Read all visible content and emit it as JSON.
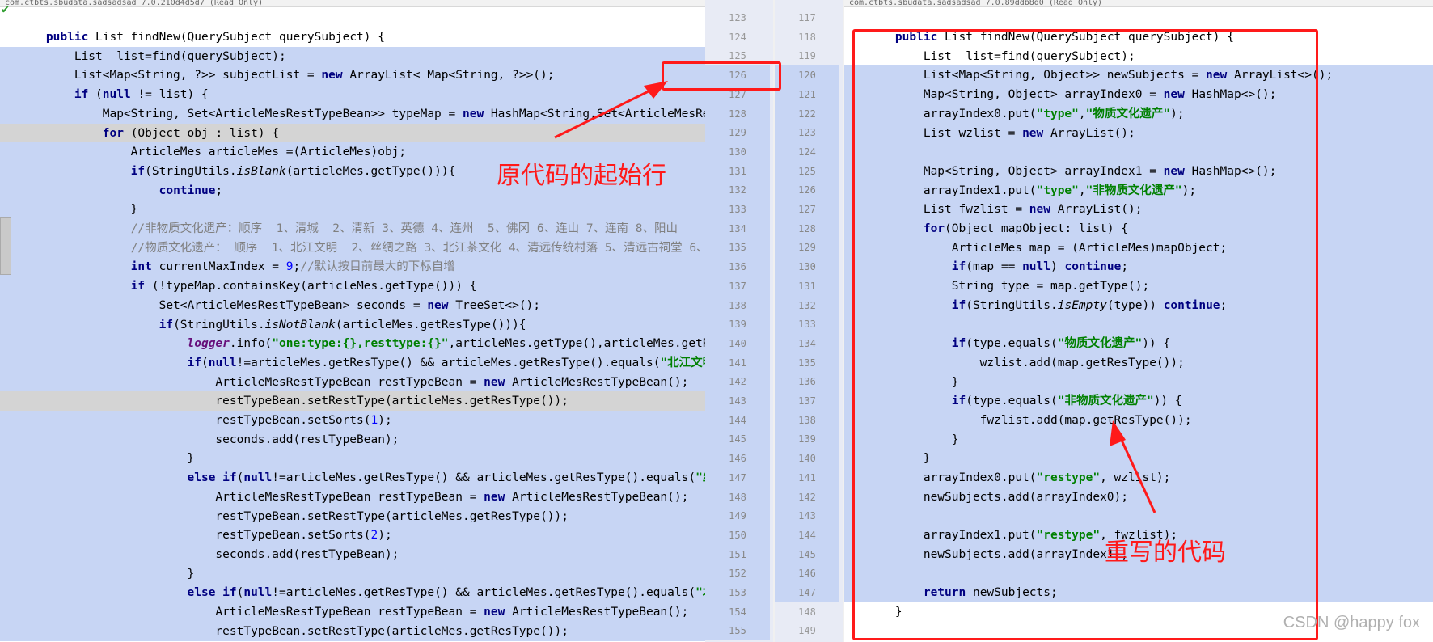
{
  "left_header": "com.ctbts.sbudata.sadsadsad 7.0.210d4d5d7 (Read Only)",
  "right_header": "com.ctbts.sbudata.sadsadsad 7.0.89ddb8d0 (Read Only)",
  "left_lines": [
    {
      "html": "    <span class='kw'>public</span> List findNew(QuerySubject querySubject) {",
      "bg": "none"
    },
    {
      "html": "        List  list=find(querySubject);",
      "bg": "sel"
    },
    {
      "html": "        List&lt;Map&lt;String, ?&gt;&gt; subjectList = <span class='kw'>new</span> ArrayList&lt; Map&lt;String, ?&gt;&gt;();",
      "bg": "sel"
    },
    {
      "html": "        <span class='kw'>if</span> (<span class='kw'>null</span> != list) {",
      "bg": "sel"
    },
    {
      "html": "            Map&lt;String, Set&lt;ArticleMesRestTypeBean&gt;&gt; typeMap = <span class='kw'>new</span> HashMap&lt;String,Set&lt;ArticleMesRestTypeBe",
      "bg": "sel"
    },
    {
      "html": "            <span class='kw'>for</span> (Object obj : list) {",
      "bg": "cur"
    },
    {
      "html": "                ArticleMes articleMes =(ArticleMes)obj;",
      "bg": "sel"
    },
    {
      "html": "                <span class='kw'>if</span>(StringUtils.<span class='ital'>isBlank</span>(articleMes.getType())){",
      "bg": "sel"
    },
    {
      "html": "                    <span class='kw'>continue</span>;",
      "bg": "sel"
    },
    {
      "html": "                }",
      "bg": "sel"
    },
    {
      "html": "                <span class='cmt'>//非物质文化遗产：顺序  1、清城  2、清新 3、英德 4、连州  5、佛冈 6、连山 7、连南 8、阳山</span>",
      "bg": "sel"
    },
    {
      "html": "                <span class='cmt'>//物质文化遗产： 顺序  1、北江文明  2、丝绸之路 3、北江茶文化 4、清远传统村落 5、清远古祠堂 6、</span>",
      "bg": "sel"
    },
    {
      "html": "                <span class='kw'>int</span> currentMaxIndex = <span class='num'>9</span>;<span class='cmt'>//默认按目前最大的下标自增</span>",
      "bg": "sel"
    },
    {
      "html": "                <span class='kw'>if</span> (!typeMap.containsKey(articleMes.getType())) {",
      "bg": "sel"
    },
    {
      "html": "                    Set&lt;ArticleMesRestTypeBean&gt; seconds = <span class='kw'>new</span> TreeSet&lt;&gt;();",
      "bg": "sel"
    },
    {
      "html": "                    <span class='kw'>if</span>(StringUtils.<span class='ital'>isNotBlank</span>(articleMes.getResType())){",
      "bg": "sel"
    },
    {
      "html": "                        <span class='field'>logger</span>.info(<span class='str'>\"one:type:{},resttype:{}\"</span>,articleMes.getType(),articleMes.getResTy",
      "bg": "sel"
    },
    {
      "html": "                        <span class='kw'>if</span>(<span class='kw'>null</span>!=articleMes.getResType() &amp;&amp; articleMes.getResType().equals(<span class='str'>\"北江文明\"</span>)) {",
      "bg": "sel"
    },
    {
      "html": "                            ArticleMesRestTypeBean restTypeBean = <span class='kw'>new</span> ArticleMesRestTypeBean();",
      "bg": "sel"
    },
    {
      "html": "                            restTypeBean.setRestType(articleMes.getResType());",
      "bg": "cur"
    },
    {
      "html": "                            restTypeBean.setSorts(<span class='num'>1</span>);",
      "bg": "sel"
    },
    {
      "html": "                            seconds.add(restTypeBean);",
      "bg": "sel"
    },
    {
      "html": "                        }",
      "bg": "sel"
    },
    {
      "html": "                        <span class='kw'>else if</span>(<span class='kw'>null</span>!=articleMes.getResType() &amp;&amp; articleMes.getResType().equals(<span class='str'>\"丝绸之路</span>",
      "bg": "sel"
    },
    {
      "html": "                            ArticleMesRestTypeBean restTypeBean = <span class='kw'>new</span> ArticleMesRestTypeBean();",
      "bg": "sel"
    },
    {
      "html": "                            restTypeBean.setRestType(articleMes.getResType());",
      "bg": "sel"
    },
    {
      "html": "                            restTypeBean.setSorts(<span class='num'>2</span>);",
      "bg": "sel"
    },
    {
      "html": "                            seconds.add(restTypeBean);",
      "bg": "sel"
    },
    {
      "html": "                        }",
      "bg": "sel"
    },
    {
      "html": "                        <span class='kw'>else if</span>(<span class='kw'>null</span>!=articleMes.getResType() &amp;&amp; articleMes.getResType().equals(<span class='str'>\"北江茶文</span>",
      "bg": "sel"
    },
    {
      "html": "                            ArticleMesRestTypeBean restTypeBean = <span class='kw'>new</span> ArticleMesRestTypeBean();",
      "bg": "sel"
    },
    {
      "html": "                            restTypeBean.setRestType(articleMes.getResType());",
      "bg": "sel"
    }
  ],
  "right_lines": [
    {
      "html": "    <span class='kw'>public</span> List findNew(QuerySubject querySubject) {",
      "bg": "none"
    },
    {
      "html": "        List  list=find(querySubject);",
      "bg": "none"
    },
    {
      "html": "        List&lt;Map&lt;String, Object&gt;&gt; newSubjects = <span class='kw'>new</span> ArrayList&lt;&gt;();",
      "bg": "sel"
    },
    {
      "html": "        Map&lt;String, Object&gt; arrayIndex0 = <span class='kw'>new</span> HashMap&lt;&gt;();",
      "bg": "sel"
    },
    {
      "html": "        arrayIndex0.put(<span class='str'>\"type\"</span>,<span class='str'>\"物质文化遗产\"</span>);",
      "bg": "sel"
    },
    {
      "html": "        List wzlist = <span class='kw'>new</span> ArrayList();",
      "bg": "sel"
    },
    {
      "html": "",
      "bg": "sel"
    },
    {
      "html": "        Map&lt;String, Object&gt; arrayIndex1 = <span class='kw'>new</span> HashMap&lt;&gt;();",
      "bg": "sel"
    },
    {
      "html": "        arrayIndex1.put(<span class='str'>\"type\"</span>,<span class='str'>\"非物质文化遗产\"</span>);",
      "bg": "sel"
    },
    {
      "html": "        List fwzlist = <span class='kw'>new</span> ArrayList();",
      "bg": "sel"
    },
    {
      "html": "        <span class='kw'>for</span>(Object mapObject: list) {",
      "bg": "sel"
    },
    {
      "html": "            ArticleMes map = (ArticleMes)mapObject;",
      "bg": "sel"
    },
    {
      "html": "            <span class='kw'>if</span>(map == <span class='kw'>null</span>) <span class='kw'>continue</span>;",
      "bg": "sel"
    },
    {
      "html": "            String type = map.getType();",
      "bg": "sel"
    },
    {
      "html": "            <span class='kw'>if</span>(StringUtils.<span class='ital'>isEmpty</span>(type)) <span class='kw'>continue</span>;",
      "bg": "sel"
    },
    {
      "html": "",
      "bg": "sel"
    },
    {
      "html": "            <span class='kw'>if</span>(type.equals(<span class='str'>\"物质文化遗产\"</span>)) {",
      "bg": "sel"
    },
    {
      "html": "                wzlist.add(map.getResType());",
      "bg": "sel"
    },
    {
      "html": "            }",
      "bg": "sel"
    },
    {
      "html": "            <span class='kw'>if</span>(type.equals(<span class='str'>\"非物质文化遗产\"</span>)) {",
      "bg": "sel"
    },
    {
      "html": "                fwzlist.add(map.getResType());",
      "bg": "sel"
    },
    {
      "html": "            }",
      "bg": "sel"
    },
    {
      "html": "        }",
      "bg": "sel"
    },
    {
      "html": "        arrayIndex0.put(<span class='str'>\"restype\"</span>, wzlist);",
      "bg": "sel"
    },
    {
      "html": "        newSubjects.add(arrayIndex0);",
      "bg": "sel"
    },
    {
      "html": "",
      "bg": "sel"
    },
    {
      "html": "        arrayIndex1.put(<span class='str'>\"restype\"</span>, fwzlist);",
      "bg": "sel"
    },
    {
      "html": "        newSubjects.add(arrayIndex1);",
      "bg": "sel"
    },
    {
      "html": "",
      "bg": "sel"
    },
    {
      "html": "        <span class='kw'>return</span> newSubjects;",
      "bg": "sel"
    },
    {
      "html": "    }",
      "bg": "none"
    }
  ],
  "gutter_left_numbers": [
    "123",
    "124",
    "125",
    "126",
    "127",
    "128",
    "129",
    "130",
    "131",
    "132",
    "133",
    "134",
    "135",
    "136",
    "137",
    "138",
    "139",
    "140",
    "141",
    "142",
    "143",
    "144",
    "145",
    "146",
    "147",
    "148",
    "149",
    "150",
    "151",
    "152",
    "153",
    "154",
    "155"
  ],
  "gutter_right_numbers": [
    "117",
    "118",
    "119",
    "120",
    "121",
    "122",
    "123",
    "124",
    "125",
    "126",
    "127",
    "128",
    "129",
    "130",
    "131",
    "132",
    "133",
    "134",
    "135",
    "136",
    "137",
    "138",
    "139",
    "140",
    "141",
    "142",
    "143",
    "144",
    "145",
    "146",
    "147",
    "148",
    "149"
  ],
  "annotations": {
    "original_start": "原代码的起始行",
    "rewritten": "重写的代码"
  },
  "watermark": "CSDN @happy fox",
  "colors": {
    "selection": "#c7d5f4",
    "annotation": "#ff1a1a"
  }
}
